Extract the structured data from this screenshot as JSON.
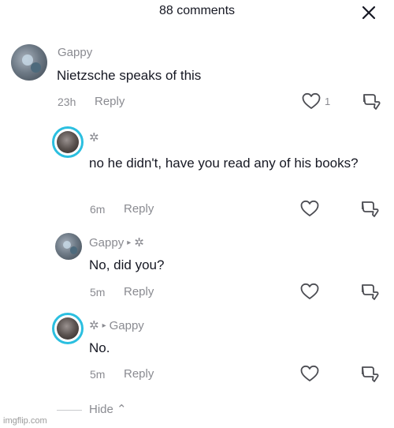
{
  "header": {
    "title": "88 comments",
    "close_icon": "close-icon"
  },
  "comments": [
    {
      "username": "Gappy",
      "text": "Nietzsche speaks of this",
      "time": "23h",
      "reply_label": "Reply",
      "like_count": "1"
    },
    {
      "username": "✲",
      "text": "no he didn't, have you read any of his books?",
      "time": "6m",
      "reply_label": "Reply"
    },
    {
      "username": "Gappy",
      "arrow": "▸",
      "reply_to": "✲",
      "text": "No, did you?",
      "time": "5m",
      "reply_label": "Reply"
    },
    {
      "username": "✲",
      "arrow": "▸",
      "reply_to": "Gappy",
      "text": "No.",
      "time": "5m",
      "reply_label": "Reply"
    }
  ],
  "footer": {
    "hide_label": "Hide ⌃"
  },
  "watermark": "imgflip.com",
  "colors": {
    "text": "#161823",
    "muted": "#8a8b91",
    "ring": "#2bbfe0"
  }
}
